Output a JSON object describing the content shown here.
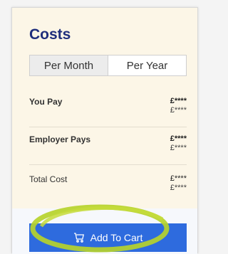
{
  "costs": {
    "title": "Costs",
    "toggle": {
      "per_month": "Per Month",
      "per_year": "Per Year",
      "selected": "per_month"
    },
    "rows": [
      {
        "label": "You Pay",
        "primary": "£****",
        "secondary": "£****"
      },
      {
        "label": "Employer Pays",
        "primary": "£****",
        "secondary": "£****"
      },
      {
        "label": "Total Cost",
        "primary": "£****",
        "secondary": "£****"
      }
    ],
    "cta_label": "Add To Cart",
    "cta_icon": "cart-icon"
  },
  "colors": {
    "title": "#1f2e7c",
    "card_bg": "#fcf6e7",
    "button": "#2e6bde",
    "highlight": "#b6d22b"
  }
}
